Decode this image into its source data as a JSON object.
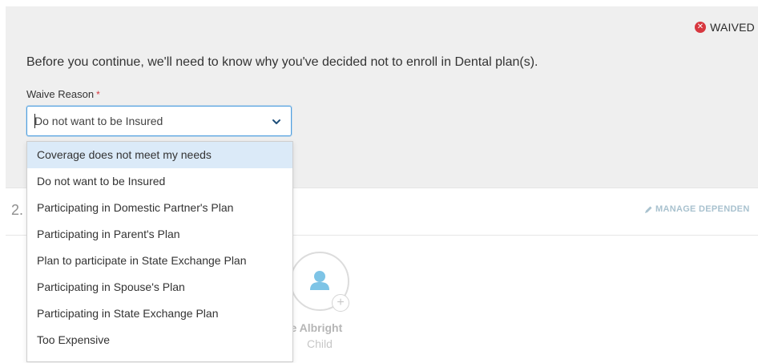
{
  "status": {
    "label": "WAIVED",
    "icon": "x-circle-icon",
    "color": "#d7373f"
  },
  "prompt": "Before you continue, we'll need to know why you've decided not to enroll in Dental plan(s).",
  "waive_field": {
    "label": "Waive Reason",
    "required_mark": "*",
    "selected_value": "Do not want to be Insured"
  },
  "dropdown_options": [
    "Coverage does not meet my needs",
    "Do not want to be Insured",
    "Participating in Domestic Partner's Plan",
    "Participating in Parent's Plan",
    "Plan to participate in State Exchange Plan",
    "Participating in Spouse's Plan",
    "Participating in State Exchange Plan",
    "Too Expensive"
  ],
  "highlighted_option_index": 0,
  "section": {
    "number": "2.",
    "manage_label": "MANAGE DEPENDEN"
  },
  "dependent": {
    "name": "ate Albright",
    "role": "Child"
  },
  "colors": {
    "accent": "#4f9fe0",
    "highlight": "#dbeaf8",
    "panel": "#efefef"
  }
}
